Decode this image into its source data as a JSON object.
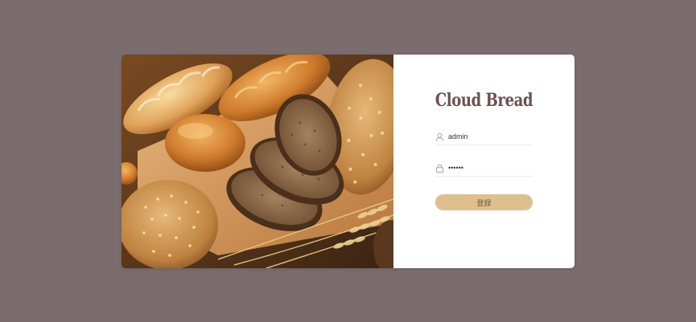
{
  "login": {
    "brand_title": "Cloud Bread",
    "username_value": "admin",
    "password_value": "••••••",
    "submit_label": "登録"
  },
  "icons": {
    "username": "user-icon",
    "password": "lock-icon"
  },
  "colors": {
    "page_background": "#7b6d6d",
    "card_background": "#ffffff",
    "brand_text": "#6a5050",
    "button_background": "#dfbf8c",
    "button_text": "#6a5a45"
  }
}
